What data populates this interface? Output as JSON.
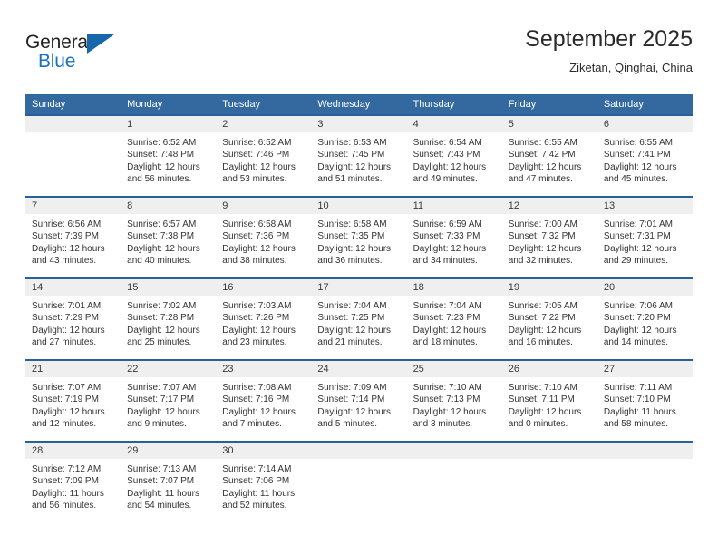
{
  "logo": {
    "word1": "General",
    "word2": "Blue",
    "triangle_color": "#1667ab",
    "blue_color": "#1d72b8"
  },
  "header": {
    "title": "September 2025",
    "location": "Ziketan, Qinghai, China"
  },
  "theme": {
    "header_bg": "#33699e",
    "row_rule": "#2a6099",
    "daynum_bg": "#efefef"
  },
  "calendar": {
    "weekday_headers": [
      "Sunday",
      "Monday",
      "Tuesday",
      "Wednesday",
      "Thursday",
      "Friday",
      "Saturday"
    ],
    "weeks": [
      [
        {
          "day": "",
          "blank": true,
          "sunrise": "",
          "sunset": "",
          "daylight1": "",
          "daylight2": ""
        },
        {
          "day": "1",
          "sunrise": "Sunrise: 6:52 AM",
          "sunset": "Sunset: 7:48 PM",
          "daylight1": "Daylight: 12 hours",
          "daylight2": "and 56 minutes."
        },
        {
          "day": "2",
          "sunrise": "Sunrise: 6:52 AM",
          "sunset": "Sunset: 7:46 PM",
          "daylight1": "Daylight: 12 hours",
          "daylight2": "and 53 minutes."
        },
        {
          "day": "3",
          "sunrise": "Sunrise: 6:53 AM",
          "sunset": "Sunset: 7:45 PM",
          "daylight1": "Daylight: 12 hours",
          "daylight2": "and 51 minutes."
        },
        {
          "day": "4",
          "sunrise": "Sunrise: 6:54 AM",
          "sunset": "Sunset: 7:43 PM",
          "daylight1": "Daylight: 12 hours",
          "daylight2": "and 49 minutes."
        },
        {
          "day": "5",
          "sunrise": "Sunrise: 6:55 AM",
          "sunset": "Sunset: 7:42 PM",
          "daylight1": "Daylight: 12 hours",
          "daylight2": "and 47 minutes."
        },
        {
          "day": "6",
          "sunrise": "Sunrise: 6:55 AM",
          "sunset": "Sunset: 7:41 PM",
          "daylight1": "Daylight: 12 hours",
          "daylight2": "and 45 minutes."
        }
      ],
      [
        {
          "day": "7",
          "sunrise": "Sunrise: 6:56 AM",
          "sunset": "Sunset: 7:39 PM",
          "daylight1": "Daylight: 12 hours",
          "daylight2": "and 43 minutes."
        },
        {
          "day": "8",
          "sunrise": "Sunrise: 6:57 AM",
          "sunset": "Sunset: 7:38 PM",
          "daylight1": "Daylight: 12 hours",
          "daylight2": "and 40 minutes."
        },
        {
          "day": "9",
          "sunrise": "Sunrise: 6:58 AM",
          "sunset": "Sunset: 7:36 PM",
          "daylight1": "Daylight: 12 hours",
          "daylight2": "and 38 minutes."
        },
        {
          "day": "10",
          "sunrise": "Sunrise: 6:58 AM",
          "sunset": "Sunset: 7:35 PM",
          "daylight1": "Daylight: 12 hours",
          "daylight2": "and 36 minutes."
        },
        {
          "day": "11",
          "sunrise": "Sunrise: 6:59 AM",
          "sunset": "Sunset: 7:33 PM",
          "daylight1": "Daylight: 12 hours",
          "daylight2": "and 34 minutes."
        },
        {
          "day": "12",
          "sunrise": "Sunrise: 7:00 AM",
          "sunset": "Sunset: 7:32 PM",
          "daylight1": "Daylight: 12 hours",
          "daylight2": "and 32 minutes."
        },
        {
          "day": "13",
          "sunrise": "Sunrise: 7:01 AM",
          "sunset": "Sunset: 7:31 PM",
          "daylight1": "Daylight: 12 hours",
          "daylight2": "and 29 minutes."
        }
      ],
      [
        {
          "day": "14",
          "sunrise": "Sunrise: 7:01 AM",
          "sunset": "Sunset: 7:29 PM",
          "daylight1": "Daylight: 12 hours",
          "daylight2": "and 27 minutes."
        },
        {
          "day": "15",
          "sunrise": "Sunrise: 7:02 AM",
          "sunset": "Sunset: 7:28 PM",
          "daylight1": "Daylight: 12 hours",
          "daylight2": "and 25 minutes."
        },
        {
          "day": "16",
          "sunrise": "Sunrise: 7:03 AM",
          "sunset": "Sunset: 7:26 PM",
          "daylight1": "Daylight: 12 hours",
          "daylight2": "and 23 minutes."
        },
        {
          "day": "17",
          "sunrise": "Sunrise: 7:04 AM",
          "sunset": "Sunset: 7:25 PM",
          "daylight1": "Daylight: 12 hours",
          "daylight2": "and 21 minutes."
        },
        {
          "day": "18",
          "sunrise": "Sunrise: 7:04 AM",
          "sunset": "Sunset: 7:23 PM",
          "daylight1": "Daylight: 12 hours",
          "daylight2": "and 18 minutes."
        },
        {
          "day": "19",
          "sunrise": "Sunrise: 7:05 AM",
          "sunset": "Sunset: 7:22 PM",
          "daylight1": "Daylight: 12 hours",
          "daylight2": "and 16 minutes."
        },
        {
          "day": "20",
          "sunrise": "Sunrise: 7:06 AM",
          "sunset": "Sunset: 7:20 PM",
          "daylight1": "Daylight: 12 hours",
          "daylight2": "and 14 minutes."
        }
      ],
      [
        {
          "day": "21",
          "sunrise": "Sunrise: 7:07 AM",
          "sunset": "Sunset: 7:19 PM",
          "daylight1": "Daylight: 12 hours",
          "daylight2": "and 12 minutes."
        },
        {
          "day": "22",
          "sunrise": "Sunrise: 7:07 AM",
          "sunset": "Sunset: 7:17 PM",
          "daylight1": "Daylight: 12 hours",
          "daylight2": "and 9 minutes."
        },
        {
          "day": "23",
          "sunrise": "Sunrise: 7:08 AM",
          "sunset": "Sunset: 7:16 PM",
          "daylight1": "Daylight: 12 hours",
          "daylight2": "and 7 minutes."
        },
        {
          "day": "24",
          "sunrise": "Sunrise: 7:09 AM",
          "sunset": "Sunset: 7:14 PM",
          "daylight1": "Daylight: 12 hours",
          "daylight2": "and 5 minutes."
        },
        {
          "day": "25",
          "sunrise": "Sunrise: 7:10 AM",
          "sunset": "Sunset: 7:13 PM",
          "daylight1": "Daylight: 12 hours",
          "daylight2": "and 3 minutes."
        },
        {
          "day": "26",
          "sunrise": "Sunrise: 7:10 AM",
          "sunset": "Sunset: 7:11 PM",
          "daylight1": "Daylight: 12 hours",
          "daylight2": "and 0 minutes."
        },
        {
          "day": "27",
          "sunrise": "Sunrise: 7:11 AM",
          "sunset": "Sunset: 7:10 PM",
          "daylight1": "Daylight: 11 hours",
          "daylight2": "and 58 minutes."
        }
      ],
      [
        {
          "day": "28",
          "sunrise": "Sunrise: 7:12 AM",
          "sunset": "Sunset: 7:09 PM",
          "daylight1": "Daylight: 11 hours",
          "daylight2": "and 56 minutes."
        },
        {
          "day": "29",
          "sunrise": "Sunrise: 7:13 AM",
          "sunset": "Sunset: 7:07 PM",
          "daylight1": "Daylight: 11 hours",
          "daylight2": "and 54 minutes."
        },
        {
          "day": "30",
          "sunrise": "Sunrise: 7:14 AM",
          "sunset": "Sunset: 7:06 PM",
          "daylight1": "Daylight: 11 hours",
          "daylight2": "and 52 minutes."
        },
        {
          "day": "",
          "blank": true,
          "sunrise": "",
          "sunset": "",
          "daylight1": "",
          "daylight2": ""
        },
        {
          "day": "",
          "blank": true,
          "sunrise": "",
          "sunset": "",
          "daylight1": "",
          "daylight2": ""
        },
        {
          "day": "",
          "blank": true,
          "sunrise": "",
          "sunset": "",
          "daylight1": "",
          "daylight2": ""
        },
        {
          "day": "",
          "blank": true,
          "sunrise": "",
          "sunset": "",
          "daylight1": "",
          "daylight2": ""
        }
      ]
    ]
  }
}
